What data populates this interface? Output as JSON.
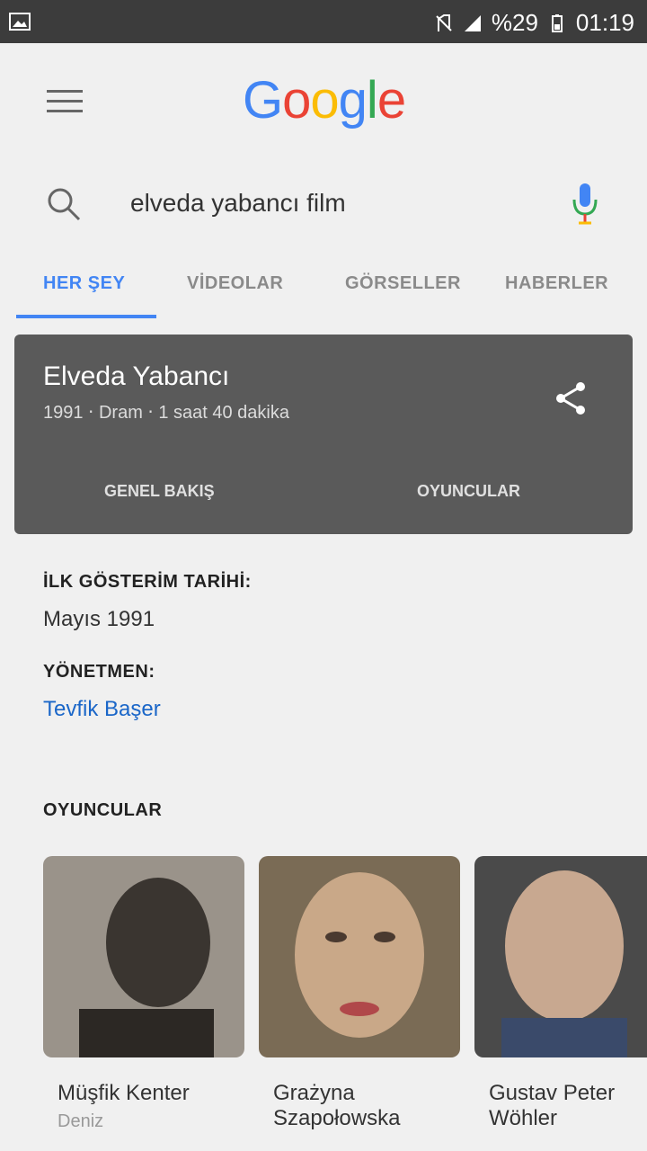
{
  "status": {
    "battery": "%29",
    "time": "01:19"
  },
  "search": {
    "query": "elveda yabancı film"
  },
  "tabs": [
    {
      "label": "HER ŞEY"
    },
    {
      "label": "VİDEOLAR"
    },
    {
      "label": "GÖRSELLER"
    },
    {
      "label": "HABERLER"
    }
  ],
  "card": {
    "title": "Elveda Yabancı",
    "subtitle": "1991 ‧ Dram ‧ 1 saat 40 dakika",
    "tabs": [
      "GENEL BAKIŞ",
      "OYUNCULAR"
    ]
  },
  "info": {
    "release_label": "İLK GÖSTERİM TARİHİ:",
    "release_value": "Mayıs 1991",
    "director_label": "YÖNETMEN:",
    "director_value": "Tevfik Başer",
    "cast_label": "OYUNCULAR"
  },
  "cast": [
    {
      "name": "Müşfik Kenter",
      "role": "Deniz"
    },
    {
      "name": "Grażyna Szapołowska",
      "role": ""
    },
    {
      "name": "Gustav Peter Wöhler",
      "role": ""
    }
  ],
  "colors": {
    "accent": "#4285f4",
    "link": "#1a66c8",
    "card_bg": "#5a5a5a"
  }
}
